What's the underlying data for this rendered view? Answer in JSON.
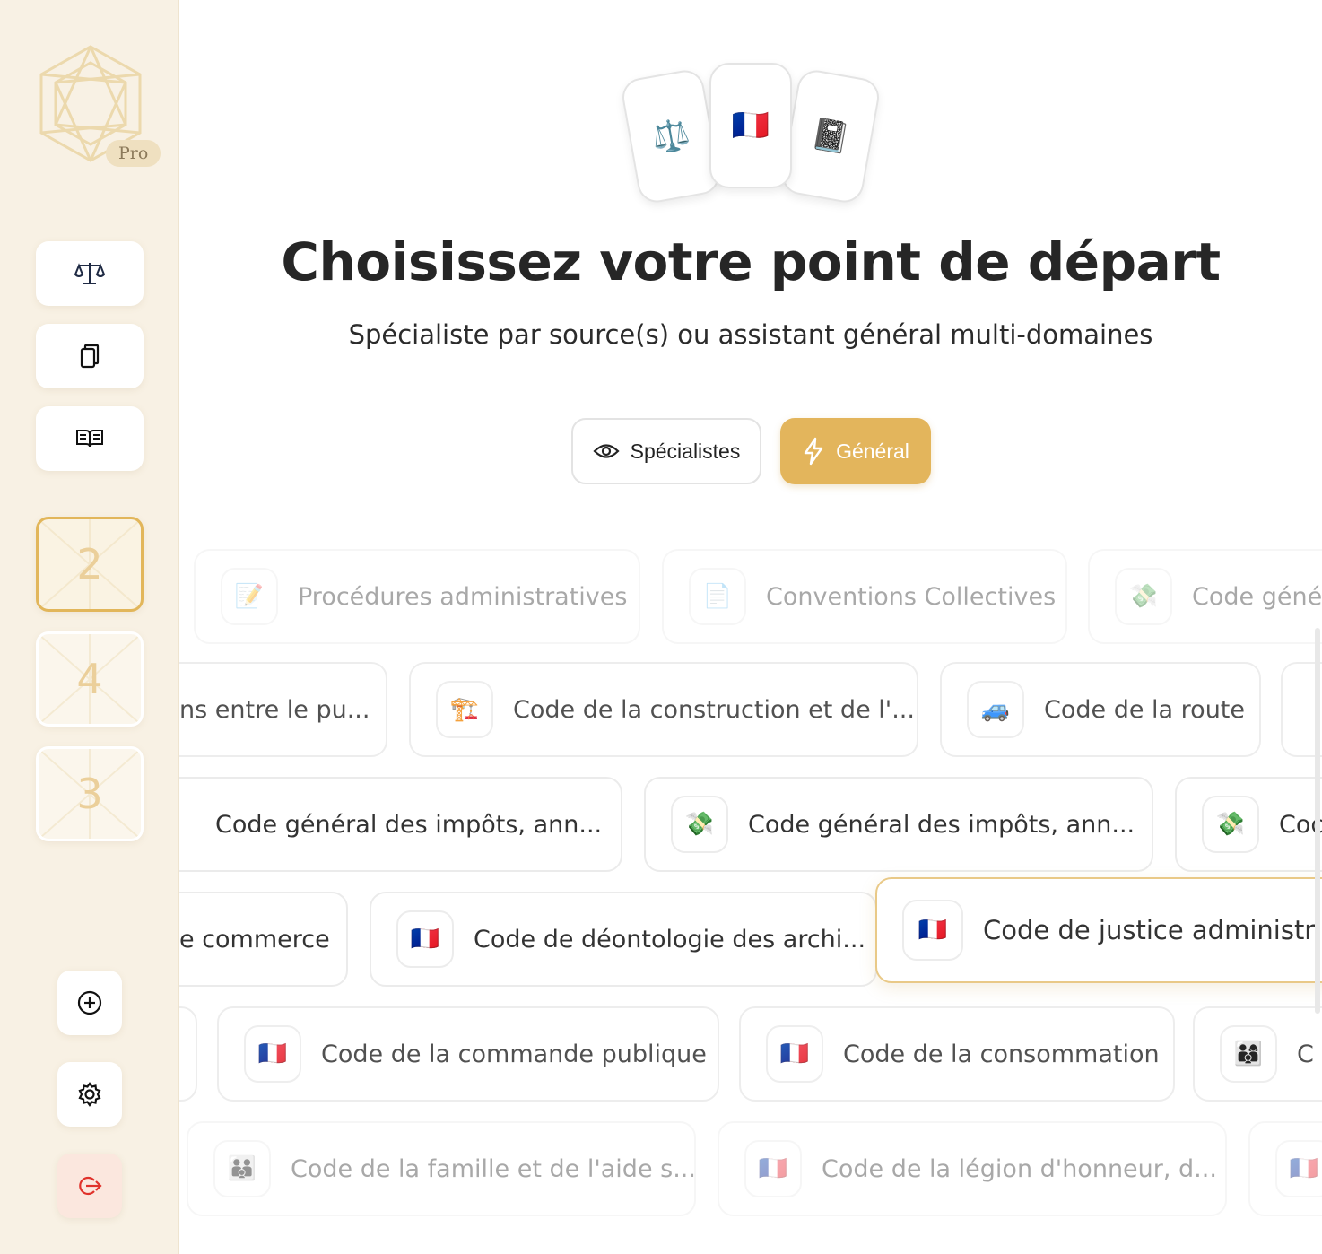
{
  "sidebar": {
    "pro_badge": "Pro",
    "nav": [
      {
        "icon": "scales-icon"
      },
      {
        "icon": "documents-icon"
      },
      {
        "icon": "open-book-icon"
      }
    ],
    "tiles": [
      {
        "number": "2",
        "active": true
      },
      {
        "number": "4",
        "active": false
      },
      {
        "number": "3",
        "active": false
      }
    ],
    "bottom": [
      {
        "icon": "add-circle-icon"
      },
      {
        "icon": "gear-icon"
      },
      {
        "icon": "logout-icon"
      }
    ]
  },
  "hero": {
    "cards": [
      "⚖️",
      "🇫🇷",
      "📓"
    ],
    "title": "Choisissez votre point de départ",
    "subtitle": "Spécialiste par source(s) ou assistant général multi-domaines"
  },
  "modes": {
    "specialists": "Spécialistes",
    "general": "Général"
  },
  "rows": [
    [
      {
        "icon": "📝",
        "label": "Procédures administratives"
      },
      {
        "icon": "📄",
        "label": "Conventions Collectives"
      },
      {
        "icon": "💸",
        "label": "Code géné"
      }
    ],
    [
      {
        "icon": "",
        "label": "ns entre le pu..."
      },
      {
        "icon": "🏗️",
        "label": "Code de la construction et de l'..."
      },
      {
        "icon": "🚙",
        "label": "Code de la route"
      },
      {
        "icon": "",
        "label": ""
      }
    ],
    [
      {
        "icon": "",
        "label": "Code général des impôts, ann..."
      },
      {
        "icon": "💸",
        "label": "Code général des impôts, ann..."
      },
      {
        "icon": "💸",
        "label": "Coc"
      }
    ],
    [
      {
        "icon": "",
        "label": "e commerce"
      },
      {
        "icon": "🇫🇷",
        "label": "Code de déontologie des archi..."
      },
      {
        "icon": "🇫🇷",
        "label": "Code de justice administr"
      }
    ],
    [
      {
        "icon": "",
        "label": ""
      },
      {
        "icon": "🇫🇷",
        "label": "Code de la commande publique"
      },
      {
        "icon": "🇫🇷",
        "label": "Code de la consommation"
      },
      {
        "icon": "👨‍👩‍👦",
        "label": "C"
      }
    ],
    [
      {
        "icon": "👪",
        "label": "Code de la famille et de l'aide s..."
      },
      {
        "icon": "🇫🇷",
        "label": "Code de la légion d'honneur, d..."
      },
      {
        "icon": "🇫🇷",
        "label": ""
      }
    ]
  ]
}
